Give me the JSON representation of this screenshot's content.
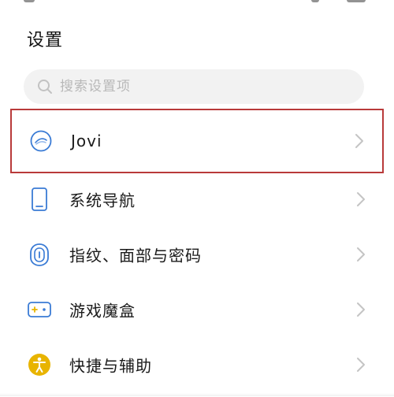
{
  "header": {
    "title": "设置"
  },
  "search": {
    "placeholder": "搜索设置项",
    "value": "",
    "icon": "search-icon"
  },
  "settings_list": {
    "items": [
      {
        "label": "Jovi",
        "icon": "jovi-icon",
        "highlighted": true
      },
      {
        "label": "系统导航",
        "icon": "phone-navigation-icon",
        "highlighted": false
      },
      {
        "label": "指纹、面部与密码",
        "icon": "fingerprint-icon",
        "highlighted": false
      },
      {
        "label": "游戏魔盒",
        "icon": "game-box-icon",
        "highlighted": false
      },
      {
        "label": "快捷与辅助",
        "icon": "accessibility-icon",
        "highlighted": false
      }
    ]
  },
  "colors": {
    "highlight_border": "#b93a3a",
    "icon_blue": "#3a7bd5",
    "icon_gold": "#e8b400",
    "chevron": "#c4c4c4",
    "search_bg": "#f2f2f2"
  }
}
